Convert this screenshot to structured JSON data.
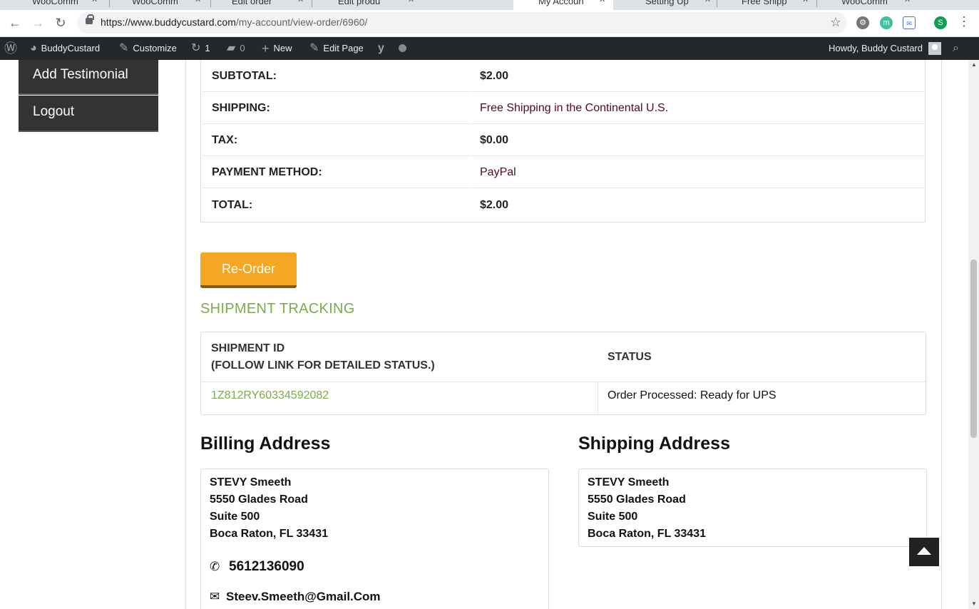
{
  "browser": {
    "tabs": [
      {
        "label": "WooComm",
        "active": false
      },
      {
        "label": "WooComm",
        "active": false
      },
      {
        "label": "Edit order",
        "active": false
      },
      {
        "label": "Edit produ",
        "active": false
      },
      {
        "label": "My Accoun",
        "active": true
      },
      {
        "label": "Setting Up",
        "active": false
      },
      {
        "label": "Free Shipp",
        "active": false
      },
      {
        "label": "WooComm",
        "active": false
      }
    ],
    "url_host": "https://www.buddycustard.com",
    "url_path": "/my-account/view-order/6960/",
    "profile_initial": "S",
    "ext_m": "m"
  },
  "adminbar": {
    "site_name": "BuddyCustard",
    "customize": "Customize",
    "updates_count": "1",
    "comments_count": "0",
    "new_label": "New",
    "edit_page": "Edit Page",
    "greeting": "Howdy, Buddy Custard"
  },
  "sidebar": {
    "items": [
      {
        "label": "Add Testimonial"
      },
      {
        "label": "Logout"
      }
    ]
  },
  "order_totals": {
    "rows": [
      {
        "label": "SUBTOTAL:",
        "value": "$2.00"
      },
      {
        "label": "SHIPPING:",
        "value": "Free Shipping in the Continental U.S."
      },
      {
        "label": "TAX:",
        "value": "$0.00"
      },
      {
        "label": "PAYMENT METHOD:",
        "value": "PayPal"
      },
      {
        "label": "TOTAL:",
        "value": "$2.00"
      }
    ]
  },
  "reorder_label": "Re-Order",
  "tracking": {
    "heading": "SHIPMENT TRACKING",
    "col_id_line1": "SHIPMENT ID",
    "col_id_line2": "(FOLLOW LINK FOR DETAILED STATUS.)",
    "col_status": "STATUS",
    "shipment_id": "1Z812RY60334592082",
    "status": "Order Processed: Ready for UPS"
  },
  "billing": {
    "title": "Billing Address",
    "name": "STEVY Smeeth",
    "line1": "5550 Glades Road",
    "line2": "Suite 500",
    "city": "Boca Raton, FL 33431",
    "phone": "5612136090",
    "email": "Steev.Smeeth@Gmail.Com"
  },
  "shipping": {
    "title": "Shipping Address",
    "name": "STEVY Smeeth",
    "line1": "5550 Glades Road",
    "line2": "Suite 500",
    "city": "Boca Raton, FL 33431"
  },
  "colors": {
    "accent_green": "#7cab4e",
    "button_orange": "#f5a623",
    "maroon_text": "#55081e",
    "sidebar_dark": "#333333"
  }
}
